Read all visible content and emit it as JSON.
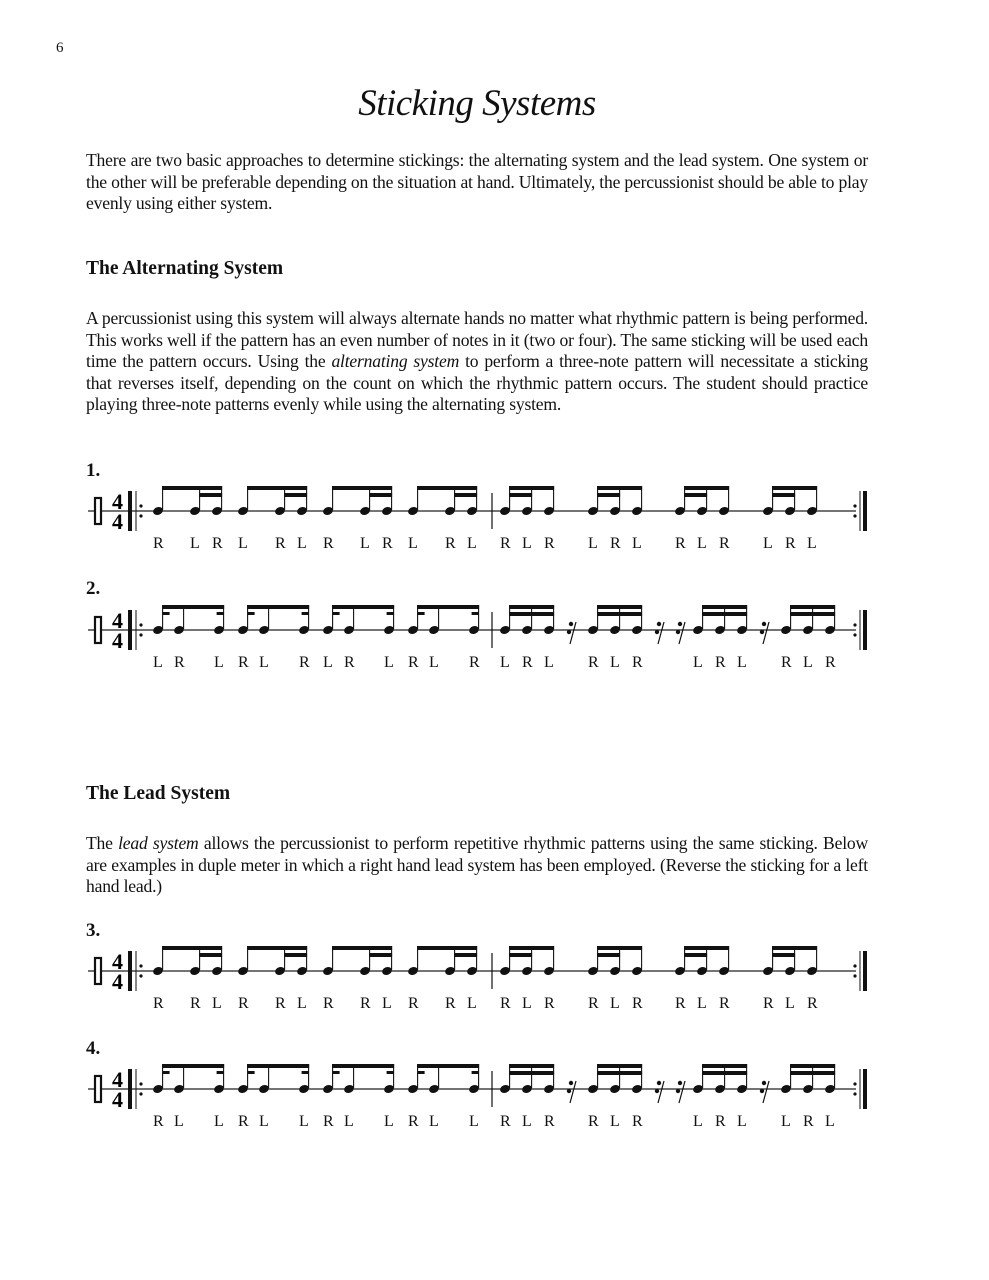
{
  "page_number": "6",
  "title": "Sticking Systems",
  "intro": "There are two basic approaches to determine stickings: the alternating system and the lead system. One system or the other will be preferable depending on the situation at hand. Ultimately, the percussionist should be able to play evenly using either system.",
  "sections": [
    {
      "heading": "The Alternating System",
      "body_parts": [
        {
          "text": "A percussionist using this system will always alternate hands no matter what rhythmic pattern is being performed. This works well if the pattern has an even number of notes in it (two or four). The same sticking will be used each time the pattern occurs. Using the ",
          "italic": false
        },
        {
          "text": "alternating system",
          "italic": true
        },
        {
          "text": " to perform a three-note pattern will necessitate a sticking that reverses itself, depending on the count on which the rhythmic pattern occurs. The student should practice playing three-note patterns evenly while using the alternating system.",
          "italic": false
        }
      ]
    },
    {
      "heading": "The Lead System",
      "body_parts": [
        {
          "text": "The ",
          "italic": false
        },
        {
          "text": "lead system",
          "italic": true
        },
        {
          "text": " allows the percussionist to perform repetitive rhythmic patterns using the same sticking. Below are examples in duple meter in which a right hand lead system has been employed. (Reverse the sticking for a left hand lead.)",
          "italic": false
        }
      ]
    }
  ],
  "time_signature": {
    "top": "4",
    "bottom": "4"
  },
  "exercises": [
    {
      "label": "1.",
      "rhythm": "A",
      "stickings": [
        "R",
        "L",
        "R",
        "L",
        "R",
        "L",
        "R",
        "L",
        "R",
        "L",
        "R",
        "L",
        "R",
        "L",
        "R",
        "L",
        "R",
        "L",
        "R",
        "L",
        "R",
        "L",
        "R",
        "L"
      ]
    },
    {
      "label": "2.",
      "rhythm": "B",
      "stickings": [
        "L",
        "R",
        "L",
        "R",
        "L",
        "R",
        "L",
        "R",
        "L",
        "R",
        "L",
        "R",
        "L",
        "R",
        "L",
        "R",
        "L",
        "R",
        "L",
        "R",
        "L",
        "R",
        "L",
        "R"
      ]
    },
    {
      "label": "3.",
      "rhythm": "A",
      "stickings": [
        "R",
        "R",
        "L",
        "R",
        "R",
        "L",
        "R",
        "R",
        "L",
        "R",
        "R",
        "L",
        "R",
        "L",
        "R",
        "R",
        "L",
        "R",
        "R",
        "L",
        "R",
        "R",
        "L",
        "R"
      ]
    },
    {
      "label": "4.",
      "rhythm": "B",
      "stickings": [
        "R",
        "L",
        "L",
        "R",
        "L",
        "L",
        "R",
        "L",
        "L",
        "R",
        "L",
        "L",
        "R",
        "L",
        "R",
        "R",
        "L",
        "R",
        "L",
        "R",
        "L",
        "L",
        "R",
        "L"
      ]
    }
  ]
}
